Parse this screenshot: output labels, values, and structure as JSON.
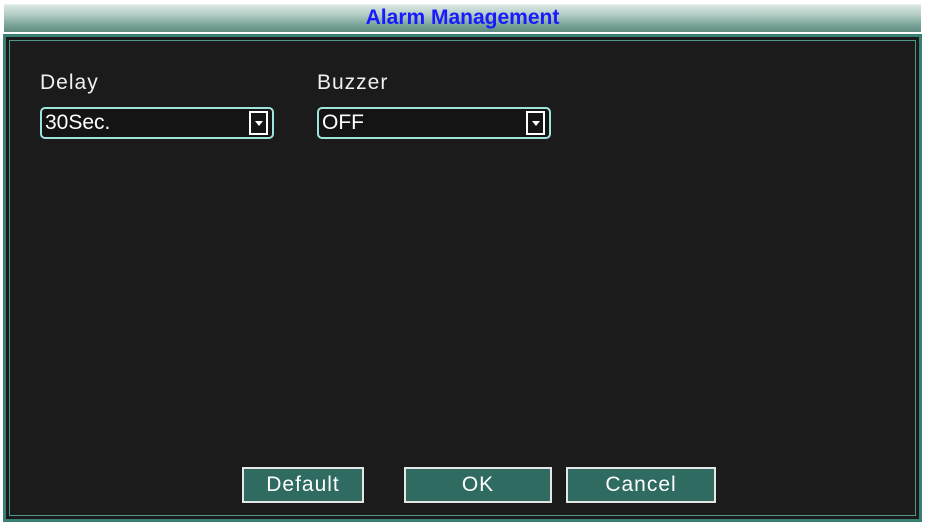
{
  "window": {
    "title": "Alarm Management"
  },
  "fields": {
    "delay": {
      "label": "Delay",
      "value": "30Sec."
    },
    "buzzer": {
      "label": "Buzzer",
      "value": "OFF"
    }
  },
  "buttons": {
    "default_label": "Default",
    "ok_label": "OK",
    "cancel_label": "Cancel"
  },
  "colors": {
    "title_text": "#1a1aff",
    "panel_background": "#1b1b1b",
    "panel_border": "#3a7f73",
    "button_background": "#2f6b61",
    "select_border": "#9fe3dd"
  },
  "icons": {
    "dropdown": "chevron-down-icon"
  }
}
